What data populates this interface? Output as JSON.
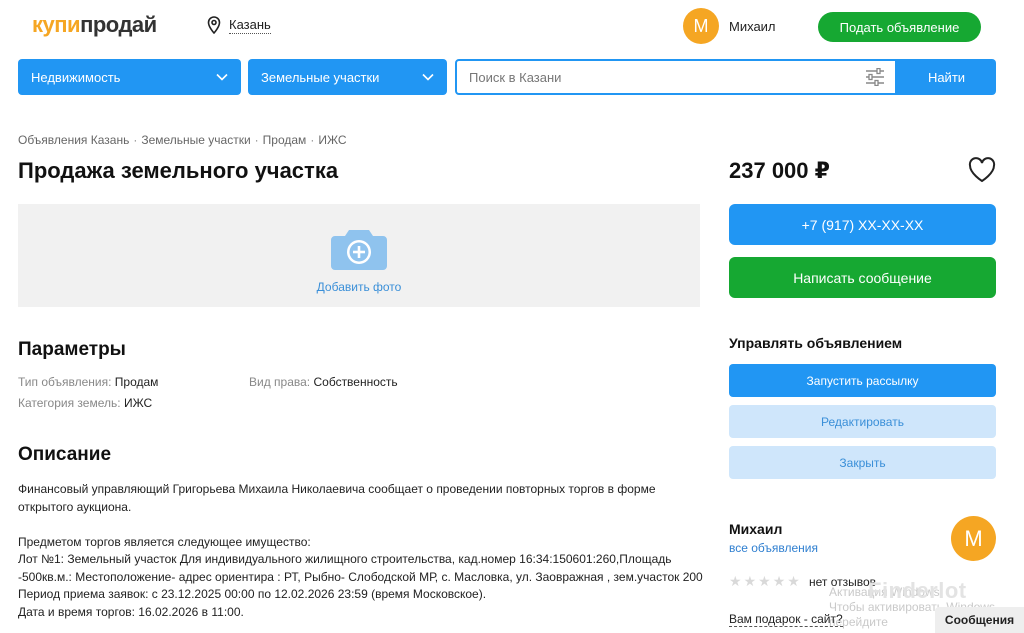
{
  "header": {
    "logo_part1": "купи",
    "logo_part2": "продай",
    "city": "Казань",
    "avatar_letter": "М",
    "user_name": "Михаил",
    "post_button": "Подать объявление"
  },
  "filters": {
    "category": "Недвижимость",
    "subcategory": "Земельные участки",
    "search_placeholder": "Поиск в Казани",
    "find_button": "Найти"
  },
  "breadcrumbs": [
    "Объявления Казань",
    "Земельные участки",
    "Продам",
    "ИЖС"
  ],
  "breadcrumb_separator": "·",
  "listing": {
    "title": "Продажа земельного участка",
    "add_photo": "Добавить фото",
    "params_heading": "Параметры",
    "params": [
      {
        "key": "Тип объявления:",
        "value": "Продам"
      },
      {
        "key": "Категория земель:",
        "value": "ИЖС"
      },
      {
        "key": "Вид права:",
        "value": "Собственность"
      }
    ],
    "description_heading": "Описание",
    "description": [
      "Финансовый управляющий Григорьева Михаила Николаевича сообщает о проведении повторных торгов в форме открытого аукциона.",
      "Предметом торгов является следующее имущество:\nЛот №1: Земельный участок Для индивидуального жилищного строительства, кад.номер 16:34:150601:260,Площадь -500кв.м.: Местоположение- адрес ориентира : РТ, Рыбно- Слободской МР, с. Масловка, ул. Заовражная , зем.участок 200\nПериод приема заявок: с 23.12.2025 00:00 по 12.02.2026 23:59 (время Московское).\nДата и время торгов: 16.02.2026 в 11:00."
    ]
  },
  "sidebar": {
    "price": "237 000 ₽",
    "phone_button": "+7 (917) XX-XX-XX",
    "message_button": "Написать сообщение",
    "manage_heading": "Управлять объявлением",
    "mailing_button": "Запустить рассылку",
    "edit_button": "Редактировать",
    "close_button": "Закрыть",
    "seller_name": "Михаил",
    "seller_all_ads": "все объявления",
    "seller_avatar_letter": "М",
    "stars_count": 0,
    "reviews": "нет отзывов",
    "gift_link": "Вам подарок - сайт?",
    "activation_hint": "Активация Windows\nЧтобы активировать Windows, перейдите",
    "watermark": "Finderlot",
    "messages_tab": "Сообщения"
  },
  "colors": {
    "accent_blue": "#2196f3",
    "accent_green": "#16a832",
    "logo_orange": "#f5a623",
    "light_blue": "#cfe6fb"
  }
}
